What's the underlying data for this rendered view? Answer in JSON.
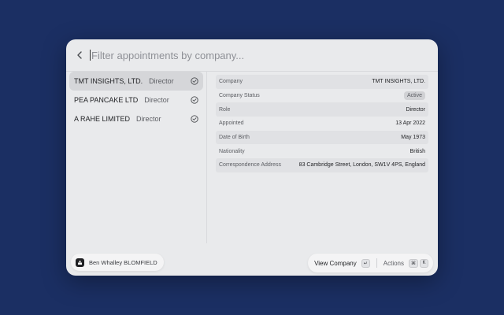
{
  "search": {
    "placeholder": "Filter appointments by company..."
  },
  "appointments": [
    {
      "company": "TMT INSIGHTS, LTD.",
      "role": "Director"
    },
    {
      "company": "PEA PANCAKE LTD",
      "role": "Director"
    },
    {
      "company": "A RAHE LIMITED",
      "role": "Director"
    }
  ],
  "details": {
    "company_label": "Company",
    "company_value": "TMT INSIGHTS, LTD.",
    "status_label": "Company Status",
    "status_value": "Active",
    "role_label": "Role",
    "role_value": "Director",
    "appointed_label": "Appointed",
    "appointed_value": "13 Apr 2022",
    "dob_label": "Date of Birth",
    "dob_value": "May 1973",
    "nationality_label": "Nationality",
    "nationality_value": "British",
    "address_label": "Correspondence Address",
    "address_value": "83 Cambridge Street, London, SW1V 4PS, England"
  },
  "footer": {
    "user_name": "Ben Whalley BLOMFIELD",
    "primary_action": "View Company",
    "primary_key": "↵",
    "secondary_action": "Actions",
    "secondary_key_1": "⌘",
    "secondary_key_2": "K"
  },
  "colors": {
    "background": "#1b2f63",
    "window": "#e9eaec",
    "selected": "#d5d6d9"
  }
}
